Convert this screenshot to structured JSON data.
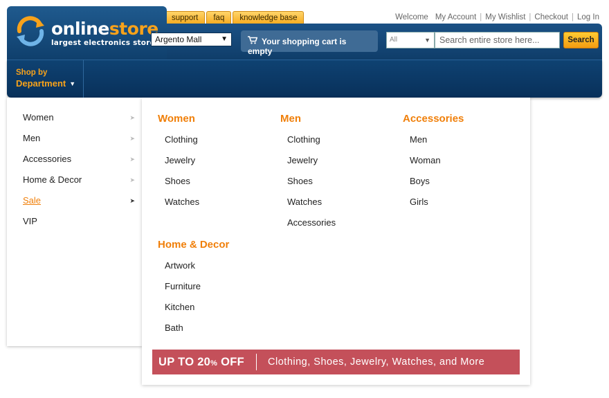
{
  "logo": {
    "word1": "online",
    "word2": "store",
    "tagline": "largest electronics store"
  },
  "top_tabs": [
    "support",
    "faq",
    "knowledge base"
  ],
  "top_links": {
    "welcome": "Welcome",
    "links": [
      "My Account",
      "My Wishlist",
      "Checkout",
      "Log In"
    ]
  },
  "store_select": {
    "value": "Argento Mall"
  },
  "cart": {
    "label": "Your shopping cart is empty"
  },
  "search": {
    "category": "All",
    "placeholder": "Search entire store here...",
    "button": "Search"
  },
  "nav": {
    "shop_by_line1": "Shop by",
    "shop_by_line2": "Department"
  },
  "left_menu": {
    "items": [
      "Women",
      "Men",
      "Accessories",
      "Home & Decor",
      "Sale",
      "VIP"
    ],
    "active": "Sale"
  },
  "mega": {
    "women": {
      "title": "Women",
      "items": [
        "Clothing",
        "Jewelry",
        "Shoes",
        "Watches"
      ]
    },
    "men": {
      "title": "Men",
      "items": [
        "Clothing",
        "Jewelry",
        "Shoes",
        "Watches",
        "Accessories"
      ]
    },
    "accessories": {
      "title": "Accessories",
      "items": [
        "Men",
        "Woman",
        "Boys",
        "Girls"
      ]
    },
    "home_decor": {
      "title": "Home & Decor",
      "items": [
        "Artwork",
        "Furniture",
        "Kitchen",
        "Bath"
      ]
    }
  },
  "promo": {
    "headline": "UP TO 20",
    "percent": "%",
    "off": " OFF",
    "text": "Clothing, Shoes, Jewelry, Watches, and More"
  },
  "colors": {
    "navy": "#0f3d69",
    "orange": "#f07f09",
    "promo": "#c4505a"
  }
}
